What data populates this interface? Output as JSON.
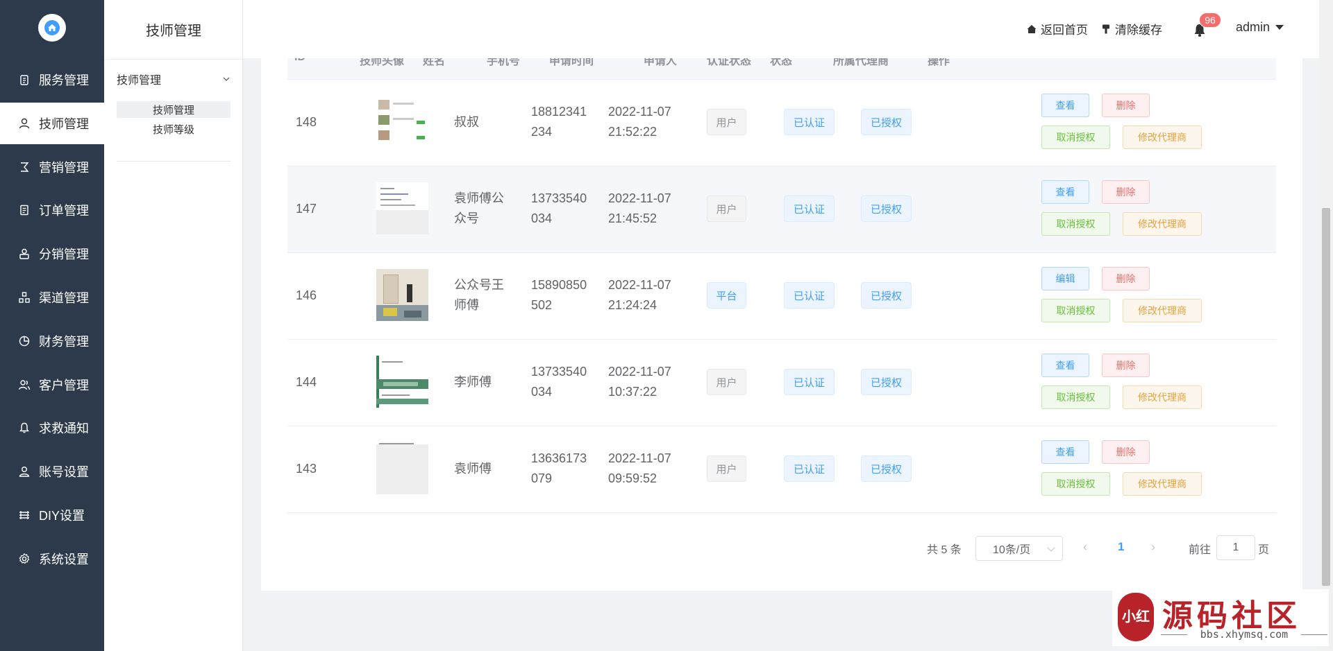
{
  "sidebar": {
    "logo_icon": "home-icon",
    "items": [
      {
        "label": "服务管理",
        "icon": "clipboard-icon",
        "active": false
      },
      {
        "label": "技师管理",
        "icon": "user-icon",
        "active": true
      },
      {
        "label": "营销管理",
        "icon": "marketing-icon",
        "active": false
      },
      {
        "label": "订单管理",
        "icon": "order-icon",
        "active": false
      },
      {
        "label": "分销管理",
        "icon": "distribution-icon",
        "active": false
      },
      {
        "label": "渠道管理",
        "icon": "channel-icon",
        "active": false
      },
      {
        "label": "财务管理",
        "icon": "pie-chart-icon",
        "active": false
      },
      {
        "label": "客户管理",
        "icon": "customers-icon",
        "active": false
      },
      {
        "label": "求救通知",
        "icon": "bell-icon",
        "active": false
      },
      {
        "label": "账号设置",
        "icon": "account-icon",
        "active": false
      },
      {
        "label": "DIY设置",
        "icon": "layers-icon",
        "active": false
      },
      {
        "label": "系统设置",
        "icon": "gear-icon",
        "active": false
      }
    ]
  },
  "subnav": {
    "title": "技师管理",
    "group": "技师管理",
    "items": [
      {
        "label": "技师管理",
        "active": true
      },
      {
        "label": "技师等级",
        "active": false
      }
    ]
  },
  "header": {
    "home_link": "返回首页",
    "clear_cache": "清除缓存",
    "notification_count": "96",
    "user": "admin"
  },
  "table": {
    "columns": [
      "ID",
      "技师头像",
      "姓名",
      "手机号",
      "申请时间",
      "申请人",
      "认证状态",
      "状态",
      "所属代理商",
      "操作"
    ],
    "rows": [
      {
        "id": "148",
        "name": [
          "叔叔",
          ""
        ],
        "phone": [
          "18812341",
          "234"
        ],
        "date": "2022-11-07",
        "time": "21:52:22",
        "applicant": "用户",
        "cert": "已认证",
        "status": "已授权",
        "agent": "",
        "primary_action": "查看",
        "delete": "删除",
        "cancel": "取消授权",
        "modify_agent": "修改代理商"
      },
      {
        "id": "147",
        "name": [
          "袁师傅公",
          "众号"
        ],
        "phone": [
          "13733540",
          "034"
        ],
        "date": "2022-11-07",
        "time": "21:45:52",
        "applicant": "用户",
        "cert": "已认证",
        "status": "已授权",
        "agent": "",
        "primary_action": "查看",
        "delete": "删除",
        "cancel": "取消授权",
        "modify_agent": "修改代理商"
      },
      {
        "id": "146",
        "name": [
          "公众号王",
          "师傅"
        ],
        "phone": [
          "15890850",
          "502"
        ],
        "date": "2022-11-07",
        "time": "21:24:24",
        "applicant": "平台",
        "cert": "已认证",
        "status": "已授权",
        "agent": "",
        "primary_action": "编辑",
        "delete": "删除",
        "cancel": "取消授权",
        "modify_agent": "修改代理商"
      },
      {
        "id": "144",
        "name": [
          "李师傅",
          ""
        ],
        "phone": [
          "13733540",
          "034"
        ],
        "date": "2022-11-07",
        "time": "10:37:22",
        "applicant": "用户",
        "cert": "已认证",
        "status": "已授权",
        "agent": "",
        "primary_action": "查看",
        "delete": "删除",
        "cancel": "取消授权",
        "modify_agent": "修改代理商"
      },
      {
        "id": "143",
        "name": [
          "袁师傅",
          ""
        ],
        "phone": [
          "13636173",
          "079"
        ],
        "date": "2022-11-07",
        "time": "09:59:52",
        "applicant": "用户",
        "cert": "已认证",
        "status": "已授权",
        "agent": "",
        "primary_action": "查看",
        "delete": "删除",
        "cancel": "取消授权",
        "modify_agent": "修改代理商"
      }
    ]
  },
  "pagination": {
    "total": "共 5 条",
    "page_size": "10条/页",
    "prev": "‹",
    "current": "1",
    "next": "›",
    "goto": "前往",
    "goto_value": "1",
    "page_suffix": "页"
  },
  "watermark": {
    "title": "源码社区",
    "url": "bbs.xhymsq.com",
    "seal": "小红"
  }
}
